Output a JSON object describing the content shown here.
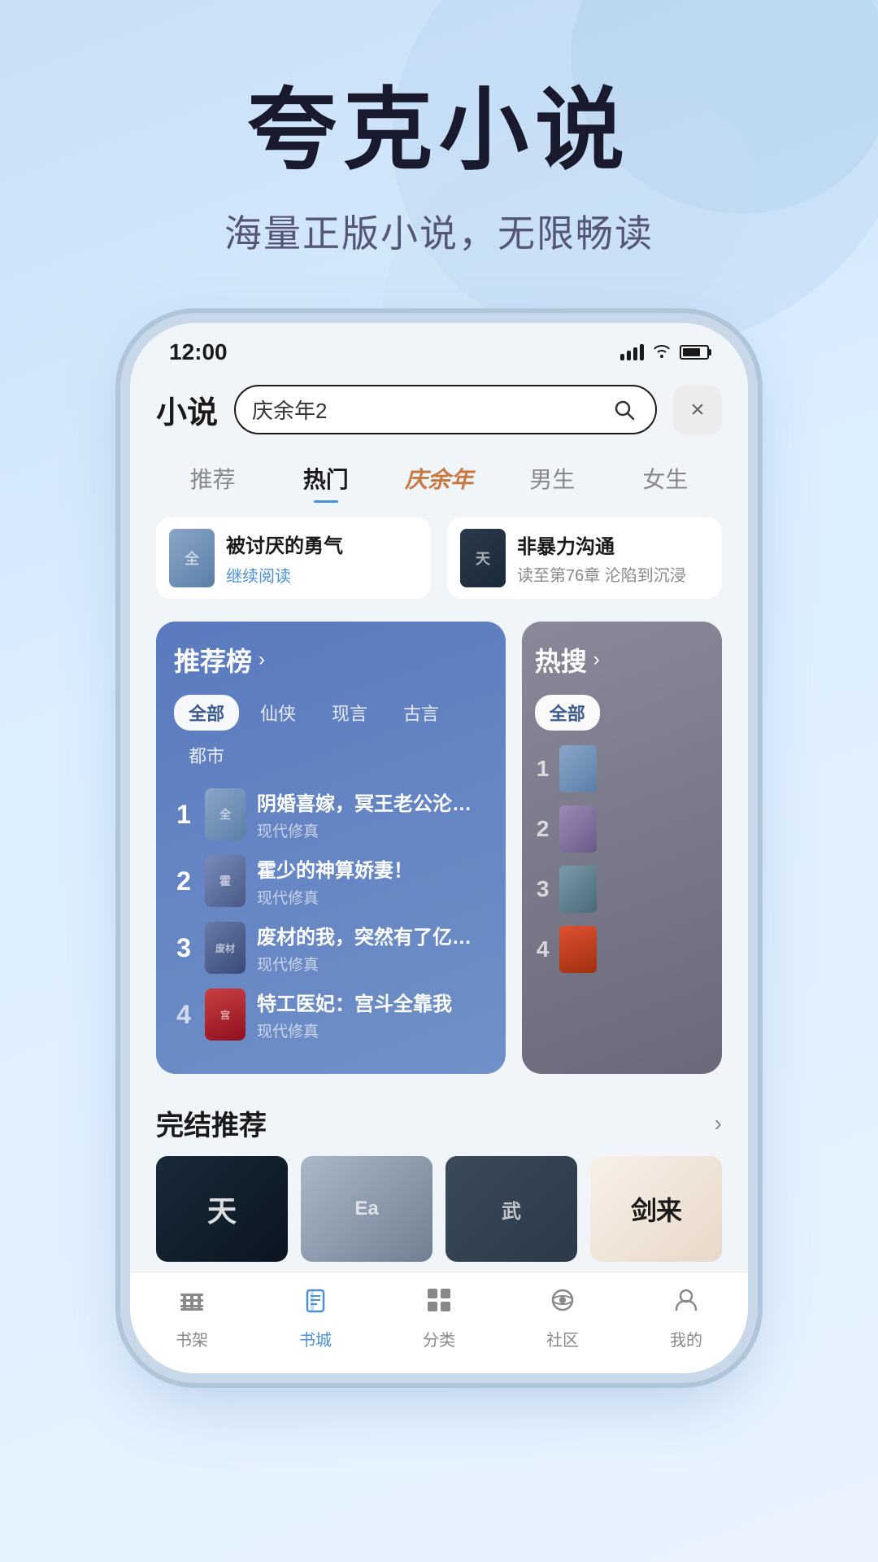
{
  "app": {
    "hero_title": "夸克小说",
    "hero_subtitle": "海量正版小说，无限畅读",
    "status_time": "12:00"
  },
  "header": {
    "logo": "小说",
    "search_placeholder": "庆余年2",
    "close_label": "×"
  },
  "tabs": [
    {
      "label": "推荐",
      "active": false,
      "special": false
    },
    {
      "label": "热门",
      "active": true,
      "special": false
    },
    {
      "label": "庆余年",
      "active": false,
      "special": true
    },
    {
      "label": "男生",
      "active": false,
      "special": false
    },
    {
      "label": "女生",
      "active": false,
      "special": false
    }
  ],
  "reading_cards": [
    {
      "title": "被讨厌的勇气",
      "progress": "继续阅读"
    },
    {
      "title": "非暴力沟通",
      "progress": "读至第76章",
      "desc": "沦陷到沉浸"
    }
  ],
  "ranking": {
    "title": "推荐榜",
    "arrow": "›",
    "filters": [
      "全部",
      "仙侠",
      "现言",
      "古言",
      "都市"
    ],
    "active_filter": "全部",
    "items": [
      {
        "rank": "1",
        "title": "阴婚喜嫁，冥王老公沦陷了",
        "genre": "现代修真"
      },
      {
        "rank": "2",
        "title": "霍少的神算娇妻！",
        "genre": "现代修真"
      },
      {
        "rank": "3",
        "title": "废材的我，突然有了亿万年",
        "genre": "现代修真"
      },
      {
        "rank": "4",
        "title": "特工医妃：宫斗全靠我",
        "genre": "现代修真"
      }
    ]
  },
  "hot_search": {
    "title": "热搜",
    "arrow": "›",
    "filters": [
      "全部"
    ],
    "items": [
      {
        "rank": "1"
      },
      {
        "rank": "2"
      },
      {
        "rank": "3"
      },
      {
        "rank": "4"
      }
    ]
  },
  "completed": {
    "title": "完结推荐",
    "arrow": "›",
    "books": [
      {
        "text": "天"
      },
      {
        "text": ""
      },
      {
        "text": ""
      },
      {
        "text": "剑来"
      }
    ]
  },
  "bottom_nav": [
    {
      "label": "书架",
      "icon": "shelf",
      "active": false
    },
    {
      "label": "书城",
      "icon": "book",
      "active": true
    },
    {
      "label": "分类",
      "icon": "grid",
      "active": false
    },
    {
      "label": "社区",
      "icon": "community",
      "active": false
    },
    {
      "label": "我的",
      "icon": "user",
      "active": false
    }
  ]
}
